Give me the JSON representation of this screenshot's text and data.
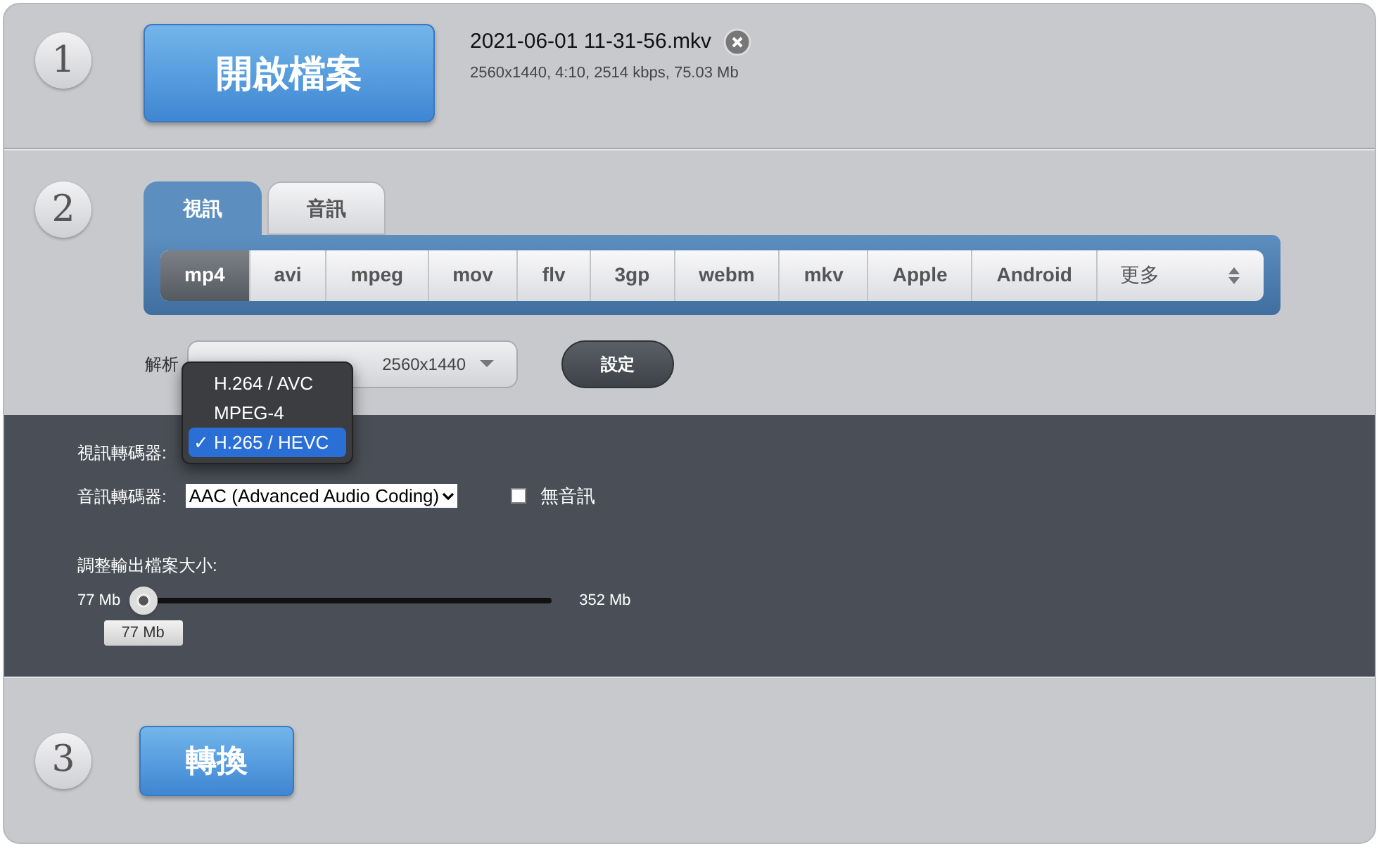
{
  "steps": [
    {
      "number": "1"
    },
    {
      "number": "2"
    },
    {
      "number": "3"
    }
  ],
  "open_button": "開啟檔案",
  "file": {
    "name": "2021-06-01 11-31-56.mkv",
    "info": "2560x1440, 4:10, 2514 kbps, 75.03 Mb"
  },
  "tabs": [
    {
      "label": "視訊",
      "selected": true
    },
    {
      "label": "音訊",
      "selected": false
    }
  ],
  "formats": [
    {
      "label": "mp4",
      "selected": true
    },
    {
      "label": "avi",
      "selected": false
    },
    {
      "label": "mpeg",
      "selected": false
    },
    {
      "label": "mov",
      "selected": false
    },
    {
      "label": "flv",
      "selected": false
    },
    {
      "label": "3gp",
      "selected": false
    },
    {
      "label": "webm",
      "selected": false
    },
    {
      "label": "mkv",
      "selected": false
    },
    {
      "label": "Apple",
      "selected": false
    },
    {
      "label": "Android",
      "selected": false
    }
  ],
  "more": "更多",
  "resolution": {
    "label": "解析",
    "size": "2560x1440"
  },
  "settings_button": "設定",
  "video_codec": {
    "label": "視訊轉碼器:",
    "options": [
      {
        "label": "H.264 / AVC",
        "selected": false
      },
      {
        "label": "MPEG-4",
        "selected": false
      },
      {
        "label": "H.265 / HEVC",
        "selected": true
      }
    ],
    "check": "✓"
  },
  "audio_codec": {
    "label": "音訊轉碼器:",
    "value": "AAC (Advanced Audio Coding)"
  },
  "no_audio": {
    "label": "無音訊",
    "checked": false
  },
  "size": {
    "label": "調整輸出檔案大小:",
    "min": "77 Mb",
    "max": "352 Mb",
    "level": 0,
    "tooltip": "77 Mb"
  },
  "convert_button": "轉換"
}
